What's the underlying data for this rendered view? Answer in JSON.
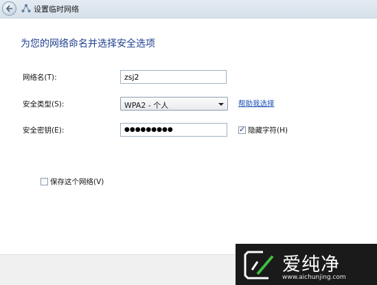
{
  "window": {
    "title": "设置临时网络"
  },
  "main": {
    "heading": "为您的网络命名并选择安全选项",
    "network_name": {
      "label": "网络名(T):",
      "value": "zsj2"
    },
    "security_type": {
      "label": "安全类型(S):",
      "selected": "WPA2 - 个人",
      "help_link": "帮助我选择"
    },
    "security_key": {
      "label": "安全密钥(E):",
      "masked_value": "●●●●●●●●●",
      "hide_chars_label": "隐藏字符(H)",
      "hide_chars_checked": true
    },
    "save_network": {
      "label": "保存这个网络(V)",
      "checked": false
    }
  },
  "watermark": {
    "brand": "爱纯净",
    "url": "www.aichunjing.com"
  }
}
